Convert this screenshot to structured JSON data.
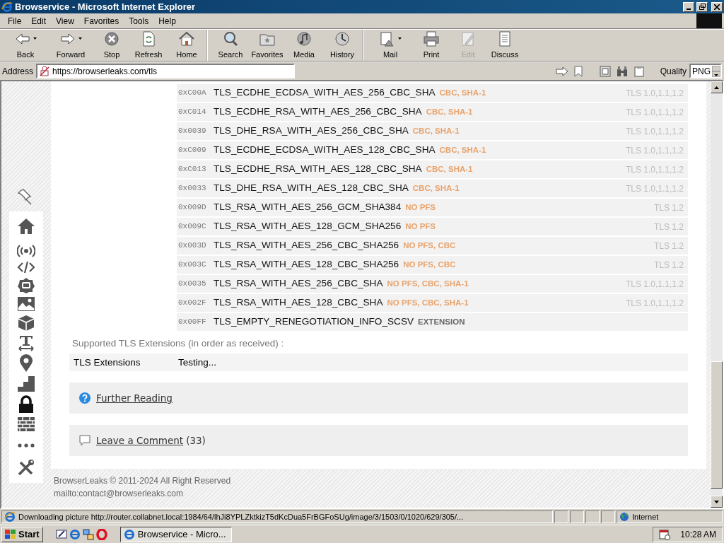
{
  "window": {
    "title": "Browservice - Microsoft Internet Explorer"
  },
  "menu": [
    "File",
    "Edit",
    "View",
    "Favorites",
    "Tools",
    "Help"
  ],
  "toolbar": [
    {
      "label": "Back",
      "dropdown": true,
      "disabled": false,
      "separator": false
    },
    {
      "label": "Forward",
      "dropdown": true,
      "disabled": false,
      "separator": false
    },
    {
      "label": "Stop",
      "dropdown": false,
      "disabled": false,
      "separator": false
    },
    {
      "label": "Refresh",
      "dropdown": false,
      "disabled": false,
      "separator": false
    },
    {
      "label": "Home",
      "dropdown": false,
      "disabled": false,
      "separator": true
    },
    {
      "label": "Search",
      "dropdown": false,
      "disabled": false,
      "separator": false
    },
    {
      "label": "Favorites",
      "dropdown": false,
      "disabled": false,
      "separator": false
    },
    {
      "label": "Media",
      "dropdown": false,
      "disabled": false,
      "separator": false
    },
    {
      "label": "History",
      "dropdown": false,
      "disabled": false,
      "separator": true
    },
    {
      "label": "Mail",
      "dropdown": true,
      "disabled": false,
      "separator": false
    },
    {
      "label": "Print",
      "dropdown": false,
      "disabled": false,
      "separator": false
    },
    {
      "label": "Edit",
      "dropdown": false,
      "disabled": true,
      "separator": false
    },
    {
      "label": "Discuss",
      "dropdown": false,
      "disabled": false,
      "separator": false
    }
  ],
  "address": {
    "label": "Address",
    "value": "https://browserleaks.com/tls"
  },
  "quality": {
    "label": "Quality",
    "value": "PNG"
  },
  "cipher_rows": [
    {
      "code": "0xC00A",
      "name": "TLS_ECDHE_ECDSA_WITH_AES_256_CBC_SHA",
      "tags": "CBC, SHA-1",
      "color": "#e8a36c",
      "versions": "TLS 1.0,1.1,1.2"
    },
    {
      "code": "0xC014",
      "name": "TLS_ECDHE_RSA_WITH_AES_256_CBC_SHA",
      "tags": "CBC, SHA-1",
      "color": "#e8a36c",
      "versions": "TLS 1.0,1.1,1.2"
    },
    {
      "code": "0x0039",
      "name": "TLS_DHE_RSA_WITH_AES_256_CBC_SHA",
      "tags": "CBC, SHA-1",
      "color": "#e8a36c",
      "versions": "TLS 1.0,1.1,1.2"
    },
    {
      "code": "0xC009",
      "name": "TLS_ECDHE_ECDSA_WITH_AES_128_CBC_SHA",
      "tags": "CBC, SHA-1",
      "color": "#e8a36c",
      "versions": "TLS 1.0,1.1,1.2"
    },
    {
      "code": "0xC013",
      "name": "TLS_ECDHE_RSA_WITH_AES_128_CBC_SHA",
      "tags": "CBC, SHA-1",
      "color": "#e8a36c",
      "versions": "TLS 1.0,1.1,1.2"
    },
    {
      "code": "0x0033",
      "name": "TLS_DHE_RSA_WITH_AES_128_CBC_SHA",
      "tags": "CBC, SHA-1",
      "color": "#e8a36c",
      "versions": "TLS 1.0,1.1,1.2"
    },
    {
      "code": "0x009D",
      "name": "TLS_RSA_WITH_AES_256_GCM_SHA384",
      "tags": "NO PFS",
      "color": "#e8a36c",
      "versions": "TLS 1.2"
    },
    {
      "code": "0x009C",
      "name": "TLS_RSA_WITH_AES_128_GCM_SHA256",
      "tags": "NO PFS",
      "color": "#e8a36c",
      "versions": "TLS 1.2"
    },
    {
      "code": "0x003D",
      "name": "TLS_RSA_WITH_AES_256_CBC_SHA256",
      "tags": "NO PFS, CBC",
      "color": "#e8a36c",
      "versions": "TLS 1.2"
    },
    {
      "code": "0x003C",
      "name": "TLS_RSA_WITH_AES_128_CBC_SHA256",
      "tags": "NO PFS, CBC",
      "color": "#e8a36c",
      "versions": "TLS 1.2"
    },
    {
      "code": "0x0035",
      "name": "TLS_RSA_WITH_AES_256_CBC_SHA",
      "tags": "NO PFS, CBC, SHA-1",
      "color": "#e8a36c",
      "versions": "TLS 1.0,1.1,1.2"
    },
    {
      "code": "0x002F",
      "name": "TLS_RSA_WITH_AES_128_CBC_SHA",
      "tags": "NO PFS, CBC, SHA-1",
      "color": "#e8a36c",
      "versions": "TLS 1.0,1.1,1.2"
    },
    {
      "code": "0x00FF",
      "name": "TLS_EMPTY_RENEGOTIATION_INFO_SCSV",
      "tags": "EXTENSION",
      "color": "#666666"
    }
  ],
  "extensions": {
    "caption": "Supported TLS Extensions (in order as received) :",
    "label": "TLS Extensions",
    "value": "Testing..."
  },
  "further_reading": {
    "link": "Further Reading"
  },
  "comments": {
    "link": "Leave a Comment",
    "count": "(33)"
  },
  "footer": [
    "BrowserLeaks © 2011-2024 All Right Reserved",
    "mailto:contact@browserleaks.com"
  ],
  "status_bar": {
    "text": "Downloading picture http://router.collabnet.local:1984/64/lhJi8YPLZktkizT5dKcDua5FrBGFoSUg/image/3/1503/0/1020/629/305/...",
    "zone": "Internet"
  },
  "taskbar": {
    "start": "Start",
    "task": "Browservice - Micro...",
    "clock": "10:28 AM"
  }
}
